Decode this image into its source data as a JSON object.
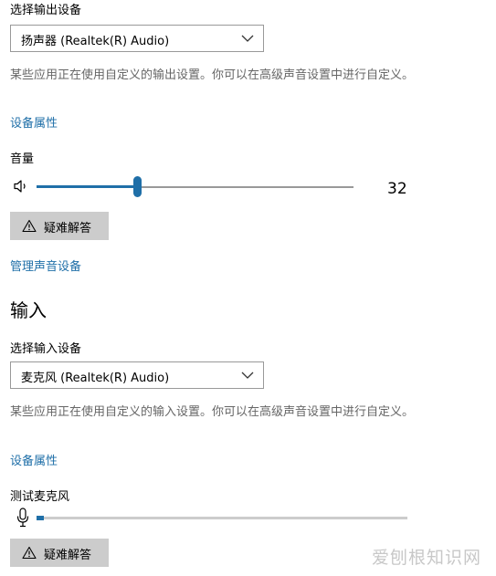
{
  "output": {
    "select_label": "选择输出设备",
    "device_value": "扬声器 (Realtek(R) Audio)",
    "description": "某些应用正在使用自定义的输出设置。你可以在高级声音设置中进行自定义。",
    "device_properties_link": "设备属性",
    "volume_label": "音量",
    "volume_value": "32",
    "volume_level_percent": 32,
    "troubleshoot_label": "疑难解答"
  },
  "manage_devices_link": "管理声音设备",
  "input": {
    "heading": "输入",
    "select_label": "选择输入设备",
    "device_value": "麦克风 (Realtek(R) Audio)",
    "description": "某些应用正在使用自定义的输入设置。你可以在高级声音设置中进行自定义。",
    "device_properties_link": "设备属性",
    "test_mic_label": "测试麦克风",
    "mic_level_percent": 2,
    "troubleshoot_label": "疑难解答"
  },
  "watermark": "爱刨根知识网",
  "icons": {
    "volume": "speaker-icon",
    "microphone": "microphone-icon",
    "warning": "warning-icon",
    "chevron": "chevron-down-icon"
  },
  "colors": {
    "accent": "#1f6fa8",
    "track": "#999999",
    "button_bg": "#cccccc",
    "description_text": "#666666"
  }
}
